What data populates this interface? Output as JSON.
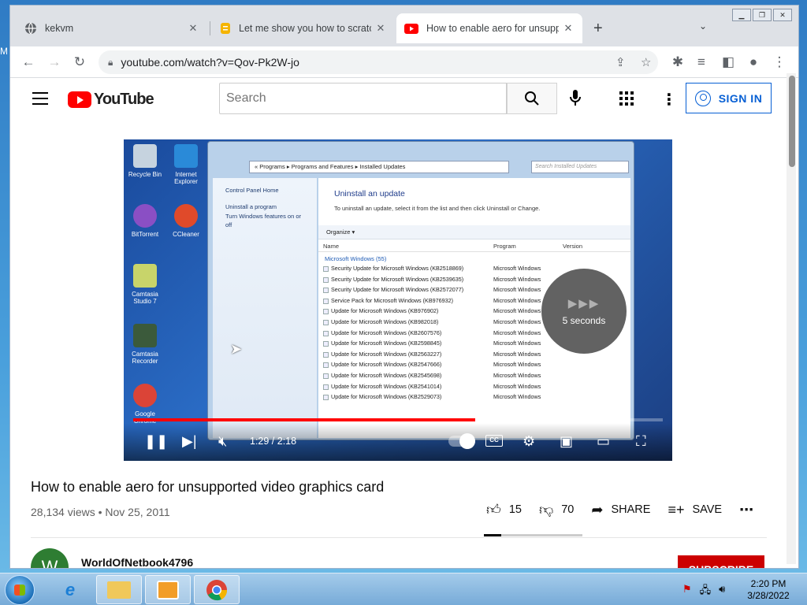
{
  "desktop": {
    "fragment": "M"
  },
  "browser": {
    "tabs": [
      {
        "title": "kekvm",
        "icon": "globe-icon"
      },
      {
        "title": "Let me show you how to scratch",
        "icon": "document-icon"
      },
      {
        "title": "How to enable aero for unsuppo",
        "icon": "youtube-icon",
        "active": true
      }
    ],
    "url": "youtube.com/watch?v=Qov-Pk2W-jo"
  },
  "youtube": {
    "logo_text": "YouTube",
    "search_placeholder": "Search",
    "sign_in": "SIGN IN"
  },
  "video_frame": {
    "desktop_icons": [
      "Recycle Bin",
      "Internet Explorer",
      "BitTorrent",
      "CCleaner",
      "Camtasia Studio 7",
      "Camtasia Recorder",
      "Google Chrome"
    ],
    "breadcrumb": "« Programs ▸ Programs and Features ▸ Installed Updates",
    "search_placeholder": "Search Installed Updates",
    "left_links": [
      "Control Panel Home",
      "Uninstall a program",
      "Turn Windows features on or off"
    ],
    "heading": "Uninstall an update",
    "subheading": "To uninstall an update, select it from the list and then click Uninstall or Change.",
    "organize": "Organize ▾",
    "columns": [
      "Name",
      "Program",
      "Version"
    ],
    "group": "Microsoft Windows (55)",
    "rows": [
      {
        "name": "Security Update for Microsoft Windows (KB2518869)",
        "program": "Microsoft Windows"
      },
      {
        "name": "Security Update for Microsoft Windows (KB2539635)",
        "program": "Microsoft Windows"
      },
      {
        "name": "Security Update for Microsoft Windows (KB2572077)",
        "program": "Microsoft Windows"
      },
      {
        "name": "Service Pack for Microsoft Windows (KB976932)",
        "program": "Microsoft Windows"
      },
      {
        "name": "Update for Microsoft Windows (KB976902)",
        "program": "Microsoft Windows"
      },
      {
        "name": "Update for Microsoft Windows (KB982018)",
        "program": "Microsoft Windows"
      },
      {
        "name": "Update for Microsoft Windows (KB2607576)",
        "program": "Microsoft Windows"
      },
      {
        "name": "Update for Microsoft Windows (KB2598845)",
        "program": "Microsoft Windows"
      },
      {
        "name": "Update for Microsoft Windows (KB2563227)",
        "program": "Microsoft Windows"
      },
      {
        "name": "Update for Microsoft Windows (KB2547666)",
        "program": "Microsoft Windows"
      },
      {
        "name": "Update for Microsoft Windows (KB2545698)",
        "program": "Microsoft Windows"
      },
      {
        "name": "Update for Microsoft Windows (KB2541014)",
        "program": "Microsoft Windows"
      },
      {
        "name": "Update for Microsoft Windows (KB2529073)",
        "program": "Microsoft Windows"
      }
    ],
    "countdown": "5 seconds"
  },
  "player": {
    "time": "1:29 / 2:18",
    "progress_fraction": 0.646,
    "buffered_fraction": 0.76
  },
  "video": {
    "title": "How to enable aero for unsupported video graphics card",
    "meta": "28,134 views • Nov 25, 2011",
    "likes": "15",
    "dislikes": "70",
    "share": "SHARE",
    "save": "SAVE",
    "like_ratio": 0.176
  },
  "channel": {
    "avatar_letter": "W",
    "name": "WorldOfNetbook4796",
    "subscribe": "SUBSCRIBE"
  },
  "taskbar": {
    "time": "2:20 PM",
    "date": "3/28/2022",
    "apps": [
      "internet-explorer-icon",
      "file-explorer-icon",
      "media-player-icon",
      "chrome-icon"
    ]
  },
  "colors": {
    "yt_red": "#ff0000",
    "link_blue": "#065fd4",
    "subscribe": "#cc0000"
  }
}
